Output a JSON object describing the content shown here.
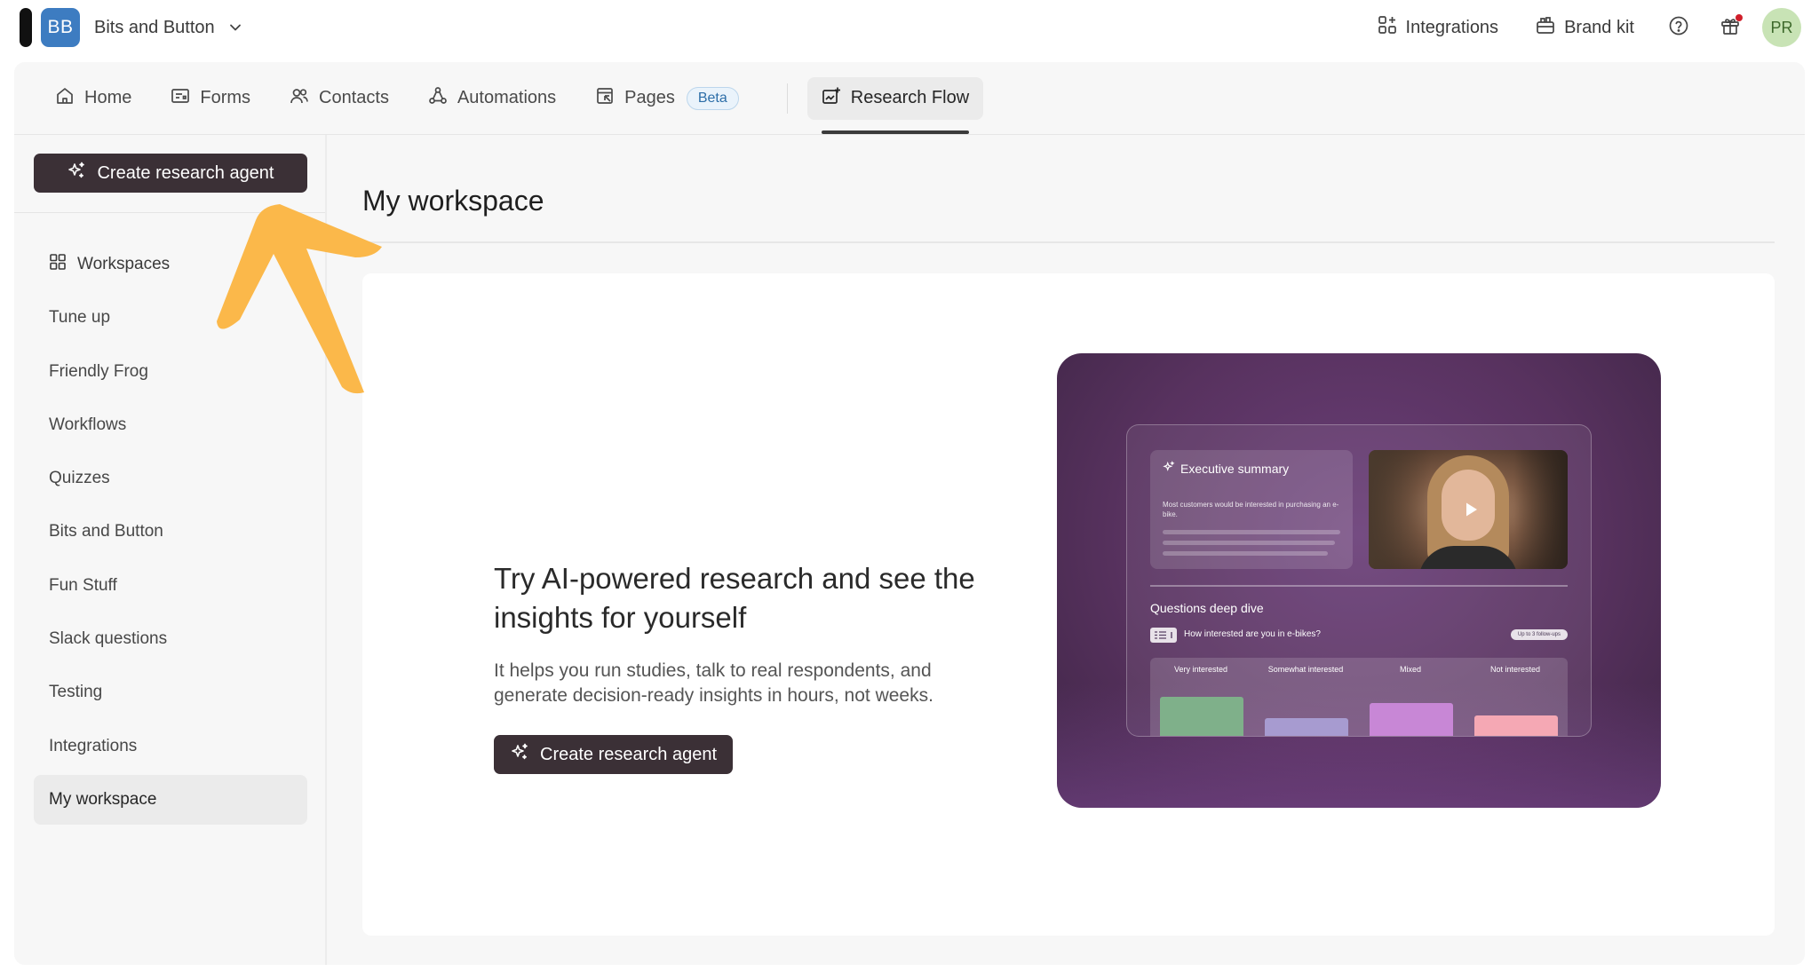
{
  "topbar": {
    "workspace_initials": "BB",
    "workspace_name": "Bits and Button",
    "integrations_label": "Integrations",
    "brand_kit_label": "Brand kit",
    "user_initials": "PR"
  },
  "tabs": [
    {
      "label": "Home",
      "icon": "home-icon"
    },
    {
      "label": "Forms",
      "icon": "forms-icon"
    },
    {
      "label": "Contacts",
      "icon": "contacts-icon"
    },
    {
      "label": "Automations",
      "icon": "automations-icon"
    },
    {
      "label": "Pages",
      "icon": "pages-icon",
      "badge": "Beta"
    },
    {
      "label": "Research Flow",
      "icon": "research-flow-icon",
      "active": true
    }
  ],
  "sidebar": {
    "create_button": "Create research agent",
    "items": [
      {
        "label": "Workspaces"
      },
      {
        "label": "Tune up"
      },
      {
        "label": "Friendly Frog"
      },
      {
        "label": "Workflows"
      },
      {
        "label": "Quizzes"
      },
      {
        "label": "Bits and Button"
      },
      {
        "label": "Fun Stuff"
      },
      {
        "label": "Slack questions"
      },
      {
        "label": "Testing"
      },
      {
        "label": "Integrations"
      },
      {
        "label": "My workspace",
        "active": true
      }
    ]
  },
  "main": {
    "title": "My workspace",
    "promo": {
      "heading": "Try AI-powered research and see the insights for yourself",
      "body": "It helps you run studies, talk to real respondents, and generate decision-ready insights in hours, not weeks.",
      "button": "Create research agent"
    }
  },
  "illustration": {
    "exec_title": "Executive summary",
    "exec_text": "Most customers would be interested in purchasing an e-bike.",
    "section_title": "Questions deep dive",
    "question": "How interested are you in e-bikes?",
    "chip": "Up to 3 follow-ups",
    "bars": [
      {
        "label": "Very interested",
        "color": "#7fb08a",
        "level": 0.88
      },
      {
        "label": "Somewhat interested",
        "color": "#a79bd0",
        "level": 0.45
      },
      {
        "label": "Mixed",
        "color": "#c887d6",
        "level": 0.75
      },
      {
        "label": "Not interested",
        "color": "#f5a8b4",
        "level": 0.5
      }
    ]
  },
  "colors": {
    "primary_button": "#3b3036",
    "annotation_arrow": "#fbb84a",
    "beta_badge": "#2d6ea8"
  }
}
